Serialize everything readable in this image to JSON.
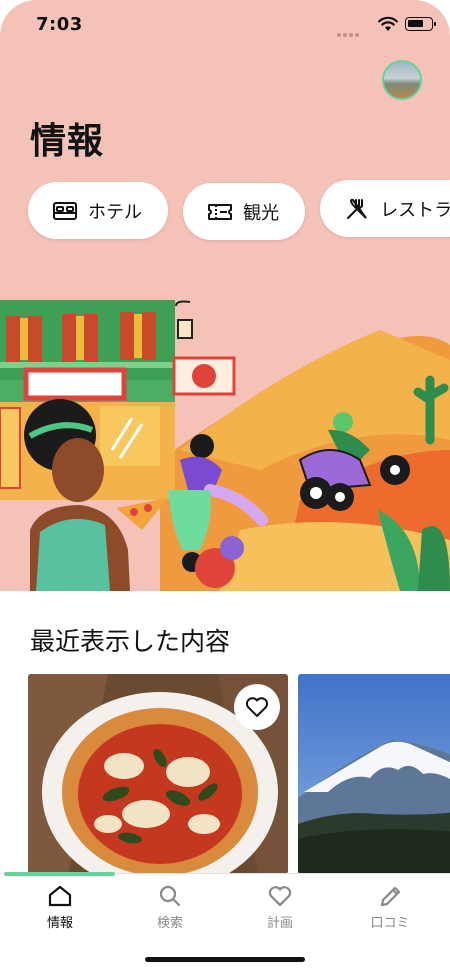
{
  "status_bar": {
    "time": "7:03"
  },
  "header": {
    "title": "情報"
  },
  "categories": [
    {
      "label": "ホテル",
      "icon": "bed-icon"
    },
    {
      "label": "観光",
      "icon": "ticket-icon"
    },
    {
      "label": "レストラ",
      "icon": "fork-knife-icon"
    }
  ],
  "recent": {
    "title": "最近表示した内容",
    "cards": [
      {
        "name": "pizza",
        "favorite_icon": "heart-icon"
      },
      {
        "name": "mount-fuji"
      }
    ]
  },
  "tabbar": {
    "active": 0,
    "items": [
      {
        "label": "情報",
        "icon": "home-icon"
      },
      {
        "label": "検索",
        "icon": "search-icon"
      },
      {
        "label": "計画",
        "icon": "heart-icon"
      },
      {
        "label": "口コミ",
        "icon": "pencil-icon"
      }
    ]
  },
  "colors": {
    "header_bg": "#f5c2b8",
    "accent": "#62d49a"
  }
}
